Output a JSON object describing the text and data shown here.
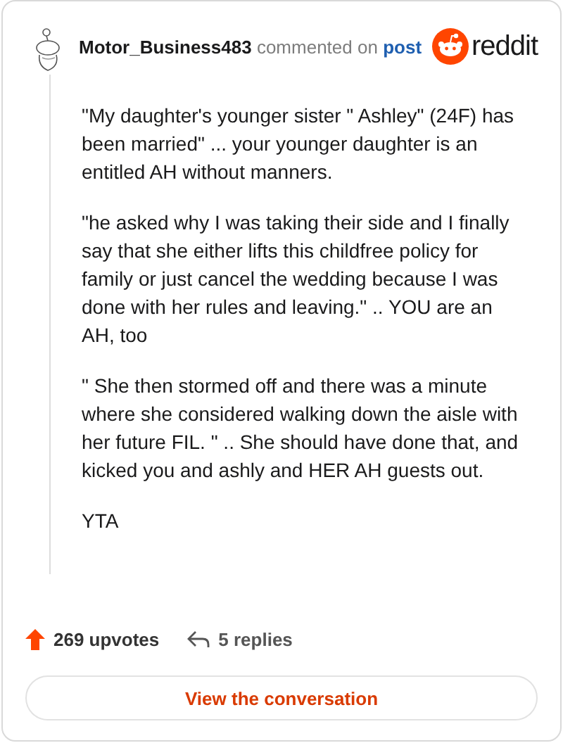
{
  "comment": {
    "author": "Motor_Business483",
    "action": "commented on",
    "link": "post",
    "paragraphs": [
      "\"My daughter's younger sister \" Ashley\" (24F) has been married\" ... your younger daughter is an entitled AH without manners.",
      "\"he asked why I was taking their side and I finally say that she either lifts this childfree policy for family or just cancel the wedding because I was done with her rules and leaving.\" .. YOU are an AH, too",
      "\" She then stormed off and there was a minute where she considered walking down the aisle with her future FIL. \" .. She should have done that, and kicked you and ashly and HER AH guests out.",
      "YTA"
    ]
  },
  "brand": "reddit",
  "footer": {
    "upvotes": "269 upvotes",
    "replies": "5 replies"
  },
  "button": "View the conversation"
}
